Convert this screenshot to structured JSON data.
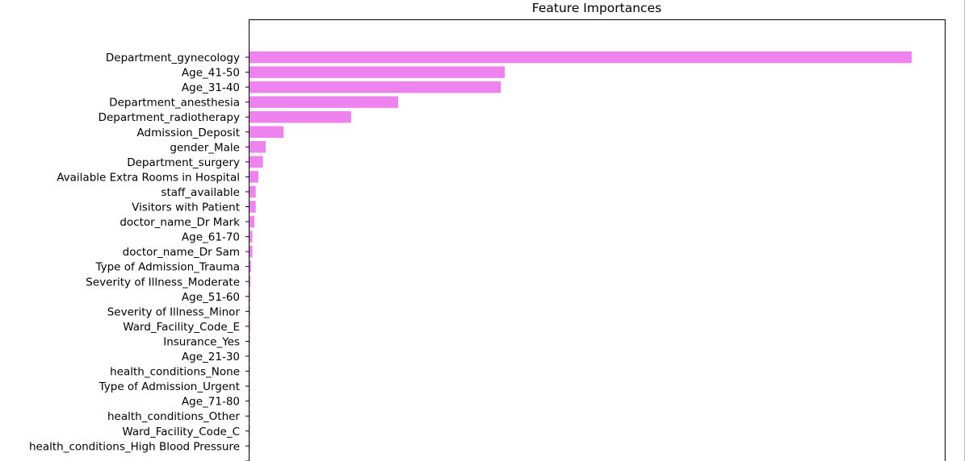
{
  "chart_data": {
    "type": "bar",
    "orientation": "horizontal",
    "title": "Feature Importances",
    "xlabel": "",
    "ylabel": "",
    "value_units": "relative importance (fraction of largest bar, estimated; x-axis not visible)",
    "bar_color": "#ee82ee",
    "grid": false,
    "categories": [
      "Department_gynecology",
      "Age_41-50",
      "Age_31-40",
      "Department_anesthesia",
      "Department_radiotherapy",
      "Admission_Deposit",
      "gender_Male",
      "Department_surgery",
      "Available Extra Rooms in Hospital",
      "staff_available",
      "Visitors with Patient",
      "doctor_name_Dr Mark",
      "Age_61-70",
      "doctor_name_Dr Sam",
      "Type of Admission_Trauma",
      "Severity of Illness_Moderate",
      "Age_51-60",
      "Severity of Illness_Minor",
      "Ward_Facility_Code_E",
      "Insurance_Yes",
      "Age_21-30",
      "health_conditions_None",
      "Type of Admission_Urgent",
      "Age_71-80",
      "health_conditions_Other",
      "Ward_Facility_Code_C",
      "health_conditions_High Blood Pressure"
    ],
    "values": [
      1.0,
      0.386,
      0.38,
      0.225,
      0.154,
      0.052,
      0.025,
      0.021,
      0.014,
      0.01,
      0.01,
      0.008,
      0.005,
      0.005,
      0.003,
      0.002,
      0.0015,
      0.0015,
      0.0015,
      0.0012,
      0.0012,
      0.001,
      0.001,
      0.001,
      0.001,
      0.001,
      0.001
    ],
    "xlim": [
      0,
      1.05
    ],
    "note": "Chart continues below the visible area; one further category label is cut off at the bottom edge."
  }
}
